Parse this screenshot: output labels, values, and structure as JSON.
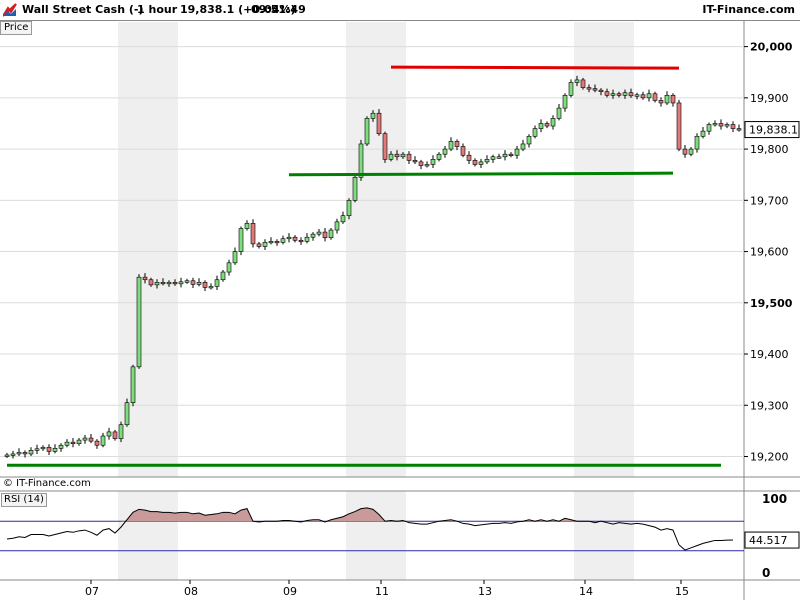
{
  "header": {
    "instrument": "Wall Street Cash (-)",
    "timeframe": "1 hour",
    "price_change": "19,838.1 (+0.04%)",
    "time": "09:51:49",
    "brand": "IT-Finance.com"
  },
  "panes": {
    "price_label": "Price",
    "watermark": "© IT-Finance.com",
    "rsi_label": "RSI (14)"
  },
  "chart_data": [
    {
      "type": "candlestick",
      "title": "Wall Street Cash (-)",
      "y_ticks": [
        "20,000",
        "19,900",
        "19,800",
        "19,700",
        "19,600",
        "19,500",
        "19,400",
        "19,300",
        "19,200"
      ],
      "y_tick_values": [
        20000,
        19900,
        19800,
        19700,
        19600,
        19500,
        19400,
        19300,
        19200
      ],
      "ylim": [
        19160,
        20050
      ],
      "x_labels": [
        "07",
        "08",
        "09",
        "11",
        "13",
        "14",
        "15"
      ],
      "last_price": "19,838.1",
      "last_price_value": 19838.1,
      "grid": "horizontal lines and alternating day bands",
      "lines": [
        {
          "color": "#e00000",
          "x_index": [
            64,
            112
          ],
          "y": [
            19960,
            19958
          ]
        },
        {
          "color": "#008000",
          "x_index": [
            47,
            111
          ],
          "y": [
            19750,
            19753
          ]
        },
        {
          "color": "#008000",
          "x_index": [
            0,
            119
          ],
          "y": [
            19183,
            19183
          ]
        }
      ],
      "close": [
        19203,
        19205,
        19208,
        19205,
        19212,
        19215,
        19218,
        19210,
        19216,
        19222,
        19228,
        19225,
        19232,
        19236,
        19230,
        19222,
        19240,
        19248,
        19235,
        19262,
        19305,
        19375,
        19550,
        19545,
        19535,
        19540,
        19538,
        19540,
        19537,
        19541,
        19543,
        19536,
        19540,
        19530,
        19532,
        19545,
        19560,
        19578,
        19600,
        19645,
        19655,
        19615,
        19610,
        19618,
        19620,
        19618,
        19625,
        19628,
        19622,
        19620,
        19628,
        19634,
        19638,
        19627,
        19642,
        19658,
        19670,
        19700,
        19745,
        19810,
        19860,
        19870,
        19830,
        19780,
        19790,
        19785,
        19790,
        19778,
        19775,
        19768,
        19770,
        19780,
        19790,
        19800,
        19815,
        19805,
        19788,
        19778,
        19770,
        19775,
        19780,
        19785,
        19785,
        19790,
        19788,
        19800,
        19810,
        19825,
        19840,
        19850,
        19845,
        19860,
        19880,
        19905,
        19930,
        19935,
        19920,
        19918,
        19915,
        19912,
        19905,
        19908,
        19905,
        19910,
        19904,
        19906,
        19900,
        19908,
        19895,
        19890,
        19905,
        19890,
        19800,
        19790,
        19800,
        19825,
        19835,
        19848,
        19850,
        19845,
        19848,
        19840,
        19838
      ]
    },
    {
      "type": "line",
      "title": "RSI (14)",
      "y_ticks": [
        "100",
        "0"
      ],
      "y_tick_values": [
        100,
        0
      ],
      "ylim": [
        0,
        100
      ],
      "levels": [
        70,
        30
      ],
      "last_value": "44.517",
      "last_value_num": 44.517,
      "x_labels": [
        "07",
        "08",
        "09",
        "11",
        "13",
        "14",
        "15"
      ],
      "values": [
        46,
        47,
        49,
        48,
        52,
        52,
        52,
        50,
        52,
        54,
        56,
        55,
        57,
        58,
        55,
        51,
        58,
        60,
        54,
        62,
        72,
        82,
        86,
        85,
        83,
        83,
        82,
        82,
        81,
        82,
        82,
        80,
        81,
        78,
        79,
        80,
        82,
        82,
        80,
        85,
        87,
        70,
        69,
        70,
        70,
        70,
        71,
        71,
        70,
        69,
        71,
        72,
        72,
        69,
        72,
        74,
        76,
        80,
        83,
        87,
        88,
        86,
        79,
        70,
        71,
        70,
        71,
        68,
        67,
        66,
        66,
        68,
        70,
        71,
        72,
        70,
        67,
        66,
        64,
        65,
        66,
        67,
        67,
        68,
        67,
        69,
        70,
        72,
        70,
        72,
        70,
        72,
        70,
        74,
        72,
        70,
        70,
        70,
        68,
        70,
        68,
        66,
        68,
        67,
        66,
        67,
        66,
        64,
        62,
        58,
        60,
        58,
        38,
        31,
        34,
        37,
        40,
        42,
        44,
        44,
        44.5,
        44.517
      ]
    }
  ]
}
